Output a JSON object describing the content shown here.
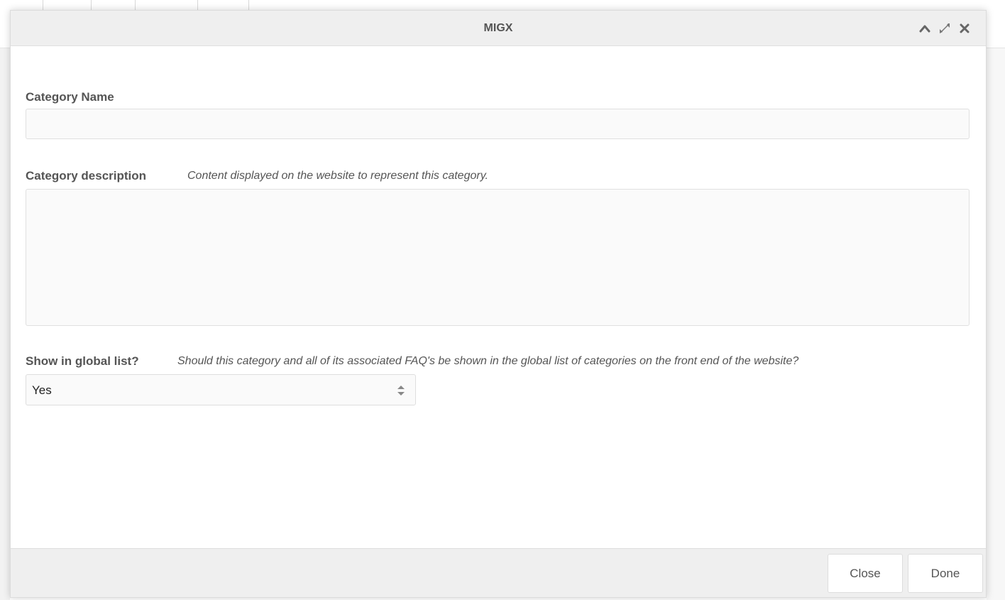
{
  "modal": {
    "title": "MIGX",
    "tools": {
      "collapse_icon": "chevron-up-icon",
      "maximize_icon": "expand-arrows-icon",
      "close_icon": "close-x-icon"
    }
  },
  "form": {
    "category_name": {
      "label": "Category Name",
      "value": ""
    },
    "category_description": {
      "label": "Category description",
      "help": "Content displayed on the website to represent this category.",
      "value": ""
    },
    "show_in_global_list": {
      "label": "Show in global list?",
      "help": "Should this category and all of its associated FAQ's be shown in the global list of categories on the front end of the website?",
      "selected": "Yes"
    }
  },
  "footer": {
    "close_label": "Close",
    "done_label": "Done"
  },
  "colors": {
    "header_bg": "#efefef",
    "footer_bg": "#efefef",
    "input_bg": "#fafafa",
    "label_text": "#555555"
  }
}
